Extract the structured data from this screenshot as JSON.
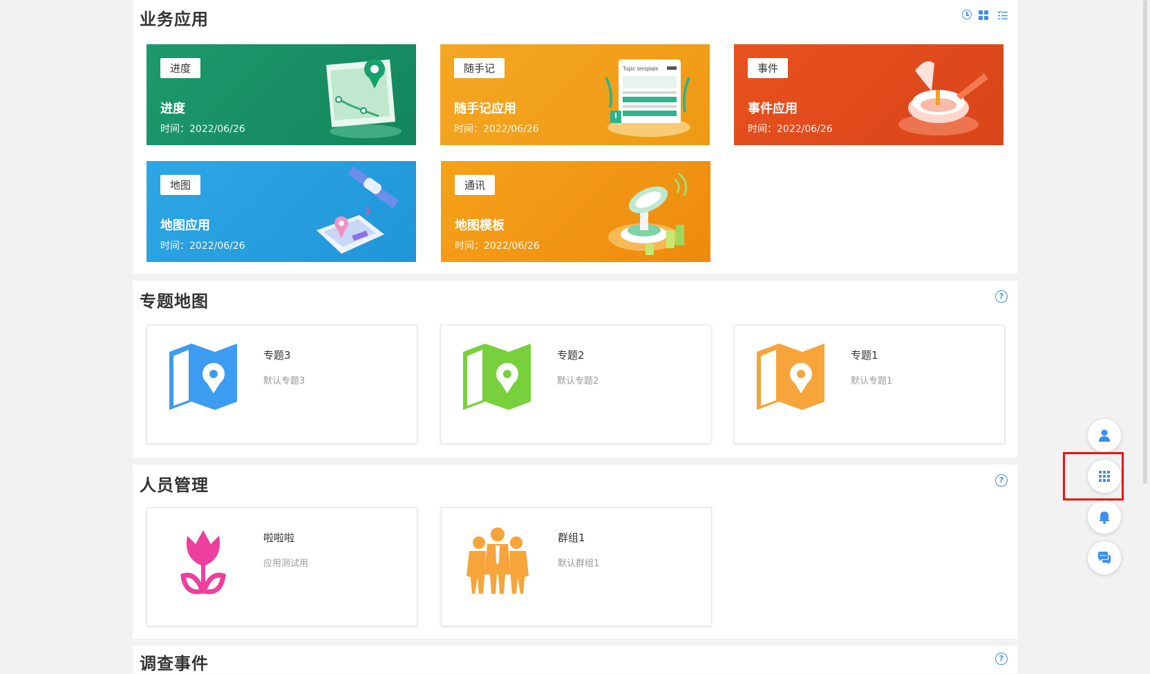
{
  "business": {
    "title": "业务应用",
    "toolbar_icons": [
      "clock-icon",
      "grid-icon",
      "list-icon"
    ],
    "apps": [
      {
        "tag": "进度",
        "name": "进度",
        "time": "时间：2022/06/26",
        "color": "#1d9a6c"
      },
      {
        "tag": "随手记",
        "name": "随手记应用",
        "time": "时间：2022/06/26",
        "color": "#f5a623"
      },
      {
        "tag": "事件",
        "name": "事件应用",
        "time": "时间：2022/06/26",
        "color": "#e8521f"
      },
      {
        "tag": "地图",
        "name": "地图应用",
        "time": "时间：2022/06/26",
        "color": "#2fa6e4"
      },
      {
        "tag": "通讯",
        "name": "地图模板",
        "time": "时间：2022/06/26",
        "color": "#f5a21a"
      }
    ]
  },
  "thematic": {
    "title": "专题地图",
    "help_icon": "?",
    "items": [
      {
        "name": "专题3",
        "desc": "默认专题3",
        "icon": "map-icon",
        "color": "#3b9cf0"
      },
      {
        "name": "专题2",
        "desc": "默认专题2",
        "icon": "map-icon",
        "color": "#78d13c"
      },
      {
        "name": "专题1",
        "desc": "默认专题1",
        "icon": "map-icon",
        "color": "#f7a43a"
      }
    ]
  },
  "people": {
    "title": "人员管理",
    "help_icon": "?",
    "items": [
      {
        "name": "啦啦啦",
        "desc": "应用测试用",
        "icon": "tulip-icon",
        "color": "#ec3f9e"
      },
      {
        "name": "群组1",
        "desc": "默认群组1",
        "icon": "group-icon",
        "color": "#f7a43a"
      }
    ]
  },
  "survey": {
    "title": "调查事件",
    "help_icon": "?"
  },
  "fabs": [
    "user-icon",
    "apps-icon",
    "bell-icon",
    "chat-icon"
  ],
  "accent": "#3b8ff0"
}
